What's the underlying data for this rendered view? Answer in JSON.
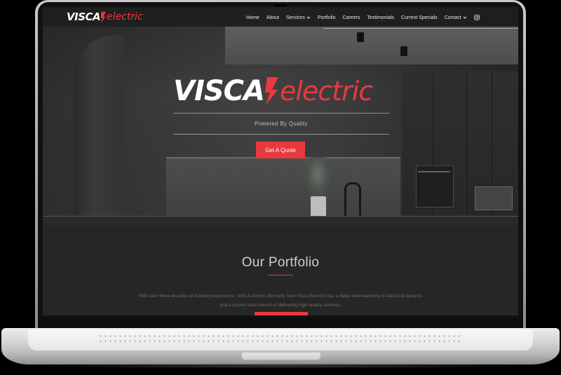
{
  "brand": {
    "name_primary": "VISCA",
    "name_secondary": "electric",
    "accent_color": "#e8393f"
  },
  "nav": {
    "items": [
      {
        "label": "Home",
        "has_dropdown": false
      },
      {
        "label": "About",
        "has_dropdown": false
      },
      {
        "label": "Services",
        "has_dropdown": true
      },
      {
        "label": "Portfolio",
        "has_dropdown": false
      },
      {
        "label": "Careers",
        "has_dropdown": false
      },
      {
        "label": "Testimonials",
        "has_dropdown": false
      },
      {
        "label": "Current Specials",
        "has_dropdown": false
      },
      {
        "label": "Contact",
        "has_dropdown": true
      }
    ],
    "social_icon": "instagram-icon"
  },
  "hero": {
    "tagline": "Powered By Quality",
    "cta_label": "Get A Quote"
  },
  "portfolio": {
    "title": "Our Portfolio",
    "body": "With over three decades of industry experience, VISCA electric (formerly Sam Visca Electric) has a deep understanding of electrical systems and a proven track record of delivering high-quality services."
  }
}
